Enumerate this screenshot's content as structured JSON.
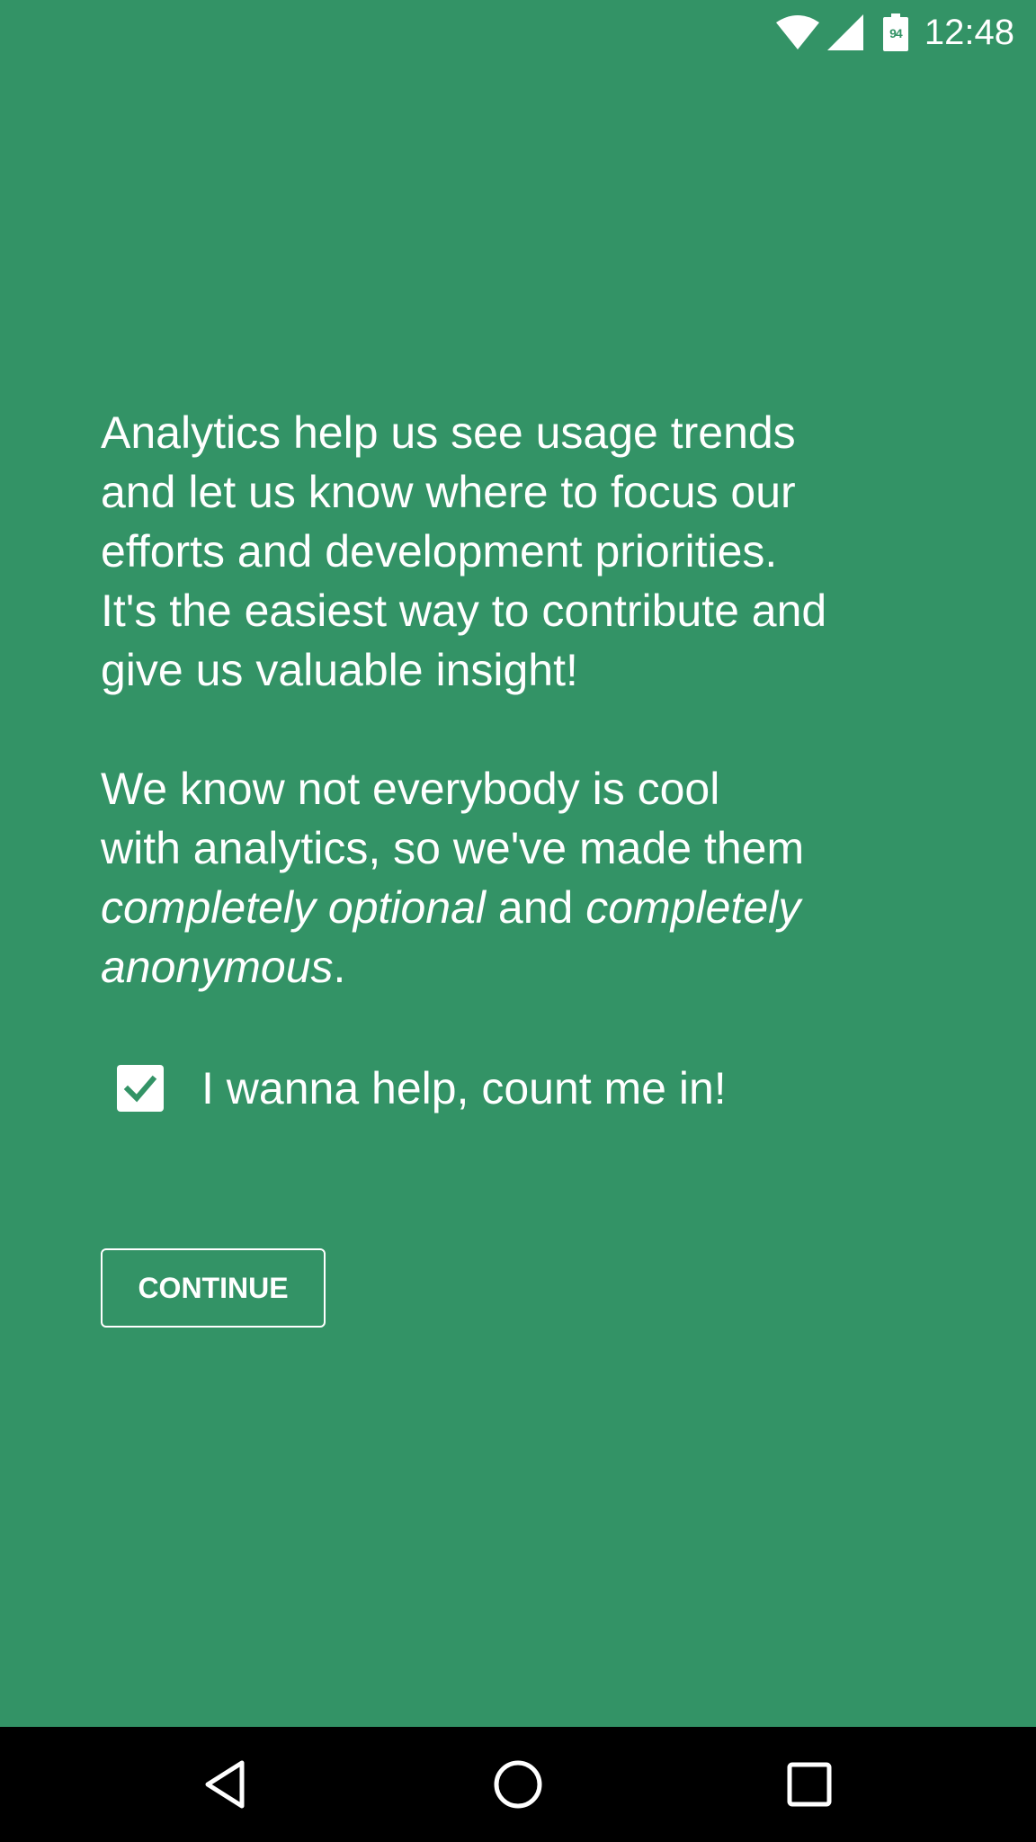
{
  "status_bar": {
    "time": "12:48",
    "battery_level": "94",
    "icons": [
      "wifi-icon",
      "cell-signal-icon",
      "battery-icon"
    ]
  },
  "intro": {
    "line1": "Analytics help us see usage trends",
    "line2": "and let us know where to focus our",
    "line3": "efforts and development priorities.",
    "line4": "It's the easiest way to contribute and",
    "line5": "give us valuable insight!"
  },
  "privacy": {
    "line1": "We know not everybody is cool",
    "line2": "with analytics, so we've made them",
    "em1": "completely optional",
    "join": " and ",
    "em2": "completely",
    "em3": "anonymous",
    "end": "."
  },
  "opt_in": {
    "label": "I wanna help, count me in!",
    "checked": true
  },
  "continue_button": {
    "label": "CONTINUE"
  },
  "nav_bar": {
    "icons": [
      "back-icon",
      "home-icon",
      "recents-icon"
    ]
  },
  "colors": {
    "background": "#339366",
    "text": "#ffffff",
    "nav_bar": "#000000"
  }
}
